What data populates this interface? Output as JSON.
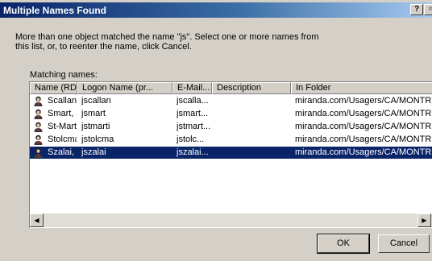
{
  "window": {
    "title": "Multiple Names Found",
    "help_label": "?",
    "close_label": "×"
  },
  "message": {
    "line1": "More than one object matched the name \"js\".  Select one or more names from",
    "line2": "this list, or, to reenter the name, click Cancel."
  },
  "list_label": "Matching names:",
  "columns": [
    "Name (RDN)",
    "Logon Name (pr...",
    "E-Mail...",
    "Description",
    "In Folder"
  ],
  "rows": [
    {
      "name": "Scallan, Ju...",
      "logon": "jscallan",
      "email": "jscalla...",
      "description": "",
      "folder": "miranda.com/Usagers/CA/MONTREA",
      "selected": false
    },
    {
      "name": "Smart, Jen...",
      "logon": "jsmart",
      "email": "jsmart...",
      "description": "",
      "folder": "miranda.com/Usagers/CA/MONTREA",
      "selected": false
    },
    {
      "name": "St-Martin, ...",
      "logon": "jstmarti",
      "email": "jstmart...",
      "description": "",
      "folder": "miranda.com/Usagers/CA/MONTREA",
      "selected": false
    },
    {
      "name": "Stolcman, ...",
      "logon": "jstolcma",
      "email": "jstolc...",
      "description": "",
      "folder": "miranda.com/Usagers/CA/MONTREA",
      "selected": false
    },
    {
      "name": "Szalai, Jeff...",
      "logon": "jszalai",
      "email": "jszalai...",
      "description": "",
      "folder": "miranda.com/Usagers/CA/MONTREA",
      "selected": true
    }
  ],
  "row_icon": "user-icon",
  "buttons": {
    "ok": "OK",
    "cancel": "Cancel"
  },
  "colors": {
    "title_start": "#0a246a",
    "title_end": "#a6caf0",
    "selection": "#0a246a",
    "face": "#d4d0c8"
  }
}
